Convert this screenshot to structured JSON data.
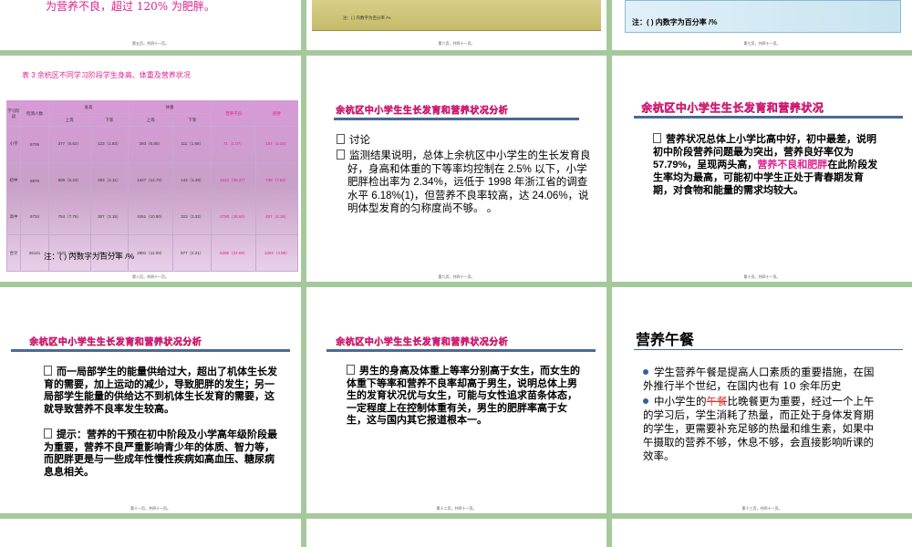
{
  "slide_top_left": {
    "text": "为营养不良，超过 120% 为肥胖。",
    "page": "第五页，共四十一页。"
  },
  "slide_top_mid": {
    "note": "注：( ) 内数字为百分率 /%",
    "page": "第六页，共四十一页。"
  },
  "slide_top_right": {
    "note": "注：( ) 内数字为百分率 /%",
    "page": "第七页，共四十一页。"
  },
  "slide_table": {
    "caption": "表 3    余杭区不同学习阶段学生身高、体重及营养状况",
    "headers": [
      "学习阶段",
      "检测人数",
      "身高",
      "体重",
      "营养不良",
      "肥胖",
      "上等",
      "下等",
      "上等",
      "下等"
    ],
    "rows": [
      {
        "stage": "小学",
        "n": "6708",
        "h_up": "377（5.62）",
        "h_down": "123（1.83）",
        "w_up": "393（5.86）",
        "w_down": "111（1.65）",
        "mal": "71（1.07）",
        "obese": "157（2.34）"
      },
      {
        "stage": "初中",
        "n": "9879",
        "h_up": "506（5.23）",
        "h_down": "204（2.11）",
        "w_up": "1427（14.74）",
        "w_down": "143（1.48）",
        "mal": "3423（35.37）",
        "obese": "738（7.62）"
      },
      {
        "stage": "高中",
        "n": "9734",
        "h_up": "754（7.75）",
        "h_down": "307（3.15）",
        "w_up": "1061（10.90）",
        "w_down": "323（3.32）",
        "mal": "2790（28.66）",
        "obese": "407（4.18）"
      },
      {
        "stage": "合计",
        "n": "26121",
        "h_up": "1637（6.27）",
        "h_down": "634（2.43）",
        "w_up": "2881（11.03）",
        "w_down": "577（2.21）",
        "mal": "6285（24.06）",
        "obese": "1302（4.98）"
      }
    ],
    "note": "注：( ) 内数字为百分率 /%",
    "page": "第八页，共四十一页。"
  },
  "slide_discuss": {
    "title": "余杭区中小学生生长发育和营养状况分析",
    "item1": "讨论",
    "item2": "监测结果说明，总体上余杭区中小学生的生长发育良好，身高和体重的下等率均控制在 2.5% 以下，小学肥胖检出率为 2.34%，远低于 1998 年浙江省的调查水平 6.18%(1)，但营养不良率较高，达 24.06%，说明体型发育的匀称度尚不够。 。",
    "page": "第九页，共四十一页。"
  },
  "slide_middle_school": {
    "title": "余杭区中小学生生长发育和营养状况",
    "text_a": "营养状况总体上小学比高中好，初中最差，说明初中阶段营养问题最为突出，营养良好率仅为 57.79%，呈现两头高，",
    "text_pink": "营养不良和肥胖",
    "text_b": "在此阶段发生率均为最高，可能初中学生正处于青春期发育期，对食物和能量的需求均较大。",
    "page": "第十页，共四十一页。"
  },
  "slide_energy": {
    "title": "余杭区中小学生生长发育和营养状况分析",
    "item1": "而一局部学生的能量供给过大，超出了机体生长发育的需要，加上运动的减少，导致肥胖的发生；另一局部学生能量的供给达不到机体生长发育的需要，这就导致营养不良率发生较高。",
    "item2": "提示：营养的干预在初中阶段及小学高年级阶段最为重要，营养不良严重影响青少年的体质、智力等，而肥胖更是与一些成年性慢性疾病如高血压、糖尿病息息相关。",
    "page": "第十一页，共四十一页。"
  },
  "slide_gender": {
    "title": "余杭区中小学生生长发育和营养状况分析",
    "item1": "男生的身高及体重上等率分别高于女生，而女生的体重下等率和营养不良率却高于男生，说明总体上男生的发育状况优与女生，可能与女性追求苗条体态，一定程度上在控制体重有关，男生的肥胖率高于女生，这与国内其它报道根本一。",
    "page": "第十二页，共四十一页。"
  },
  "slide_lunch": {
    "title": "营养午餐",
    "item1": "学生营养午餐是提高人口素质的重要措施，在国外推行半个世纪，在国内也有 10 余年历史",
    "item2_a": "中小学生的",
    "item2_strike": "午餐",
    "item2_b": "比晚餐更为重要，经过一个上午的学习后，学生消耗了热量，而正处于身体发育期的学生，更需要补充足够的热量和维生素，如果中午摄取的营养不够，休息不够，会直接影响听课的效率。",
    "page": "第十三页，共四十一页。"
  }
}
